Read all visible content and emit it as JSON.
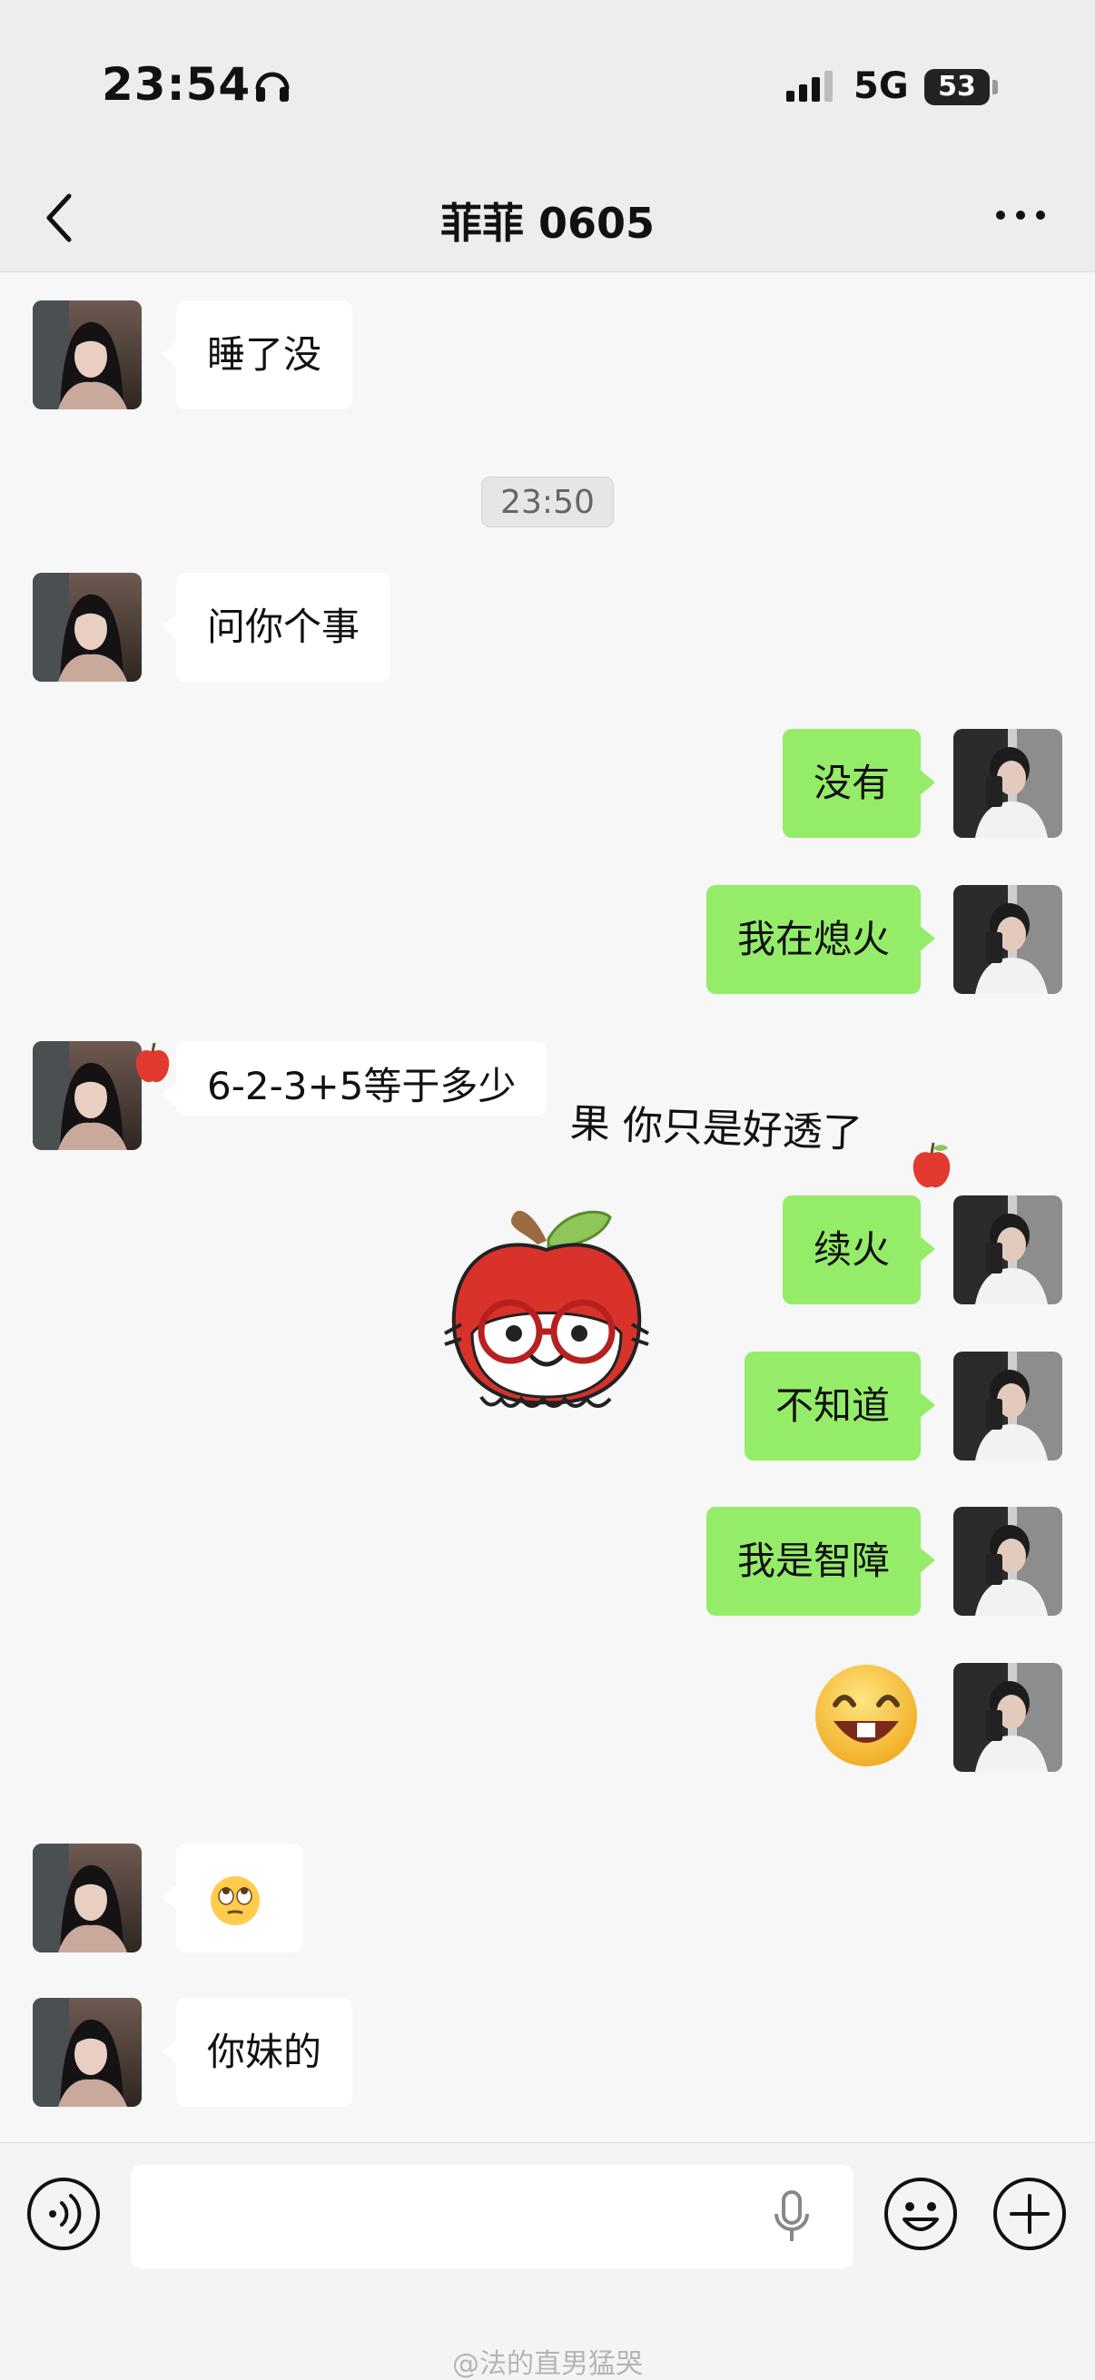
{
  "status_bar": {
    "time": "23:54",
    "network": "5G",
    "battery": "53"
  },
  "header": {
    "title": "菲菲 0605"
  },
  "messages": [
    {
      "side": "in",
      "text": "睡了没"
    },
    {
      "timestamp": "23:50"
    },
    {
      "side": "in",
      "text": "问你个事"
    },
    {
      "side": "out",
      "text": "没有"
    },
    {
      "side": "out",
      "text": "我在熄火"
    },
    {
      "side": "in",
      "text": "6-2-3+5等于多少"
    },
    {
      "side": "in",
      "sticker": "apple-glasses-sticker",
      "caption": "果 你只是好透了"
    },
    {
      "side": "out",
      "text": "续火"
    },
    {
      "side": "out",
      "text": "不知道"
    },
    {
      "side": "out",
      "text": "我是智障"
    },
    {
      "side": "out",
      "emoji": "grinning-face-emoji"
    },
    {
      "side": "in",
      "emoji": "eye-roll-emoji"
    },
    {
      "side": "in",
      "text": "你妹的"
    }
  ],
  "input_bar": {
    "placeholder": ""
  },
  "watermark": "@法的直男猛哭",
  "colors": {
    "outgoing_bubble": "#95ec69",
    "incoming_bubble": "#ffffff",
    "background": "#f7f7f7"
  }
}
